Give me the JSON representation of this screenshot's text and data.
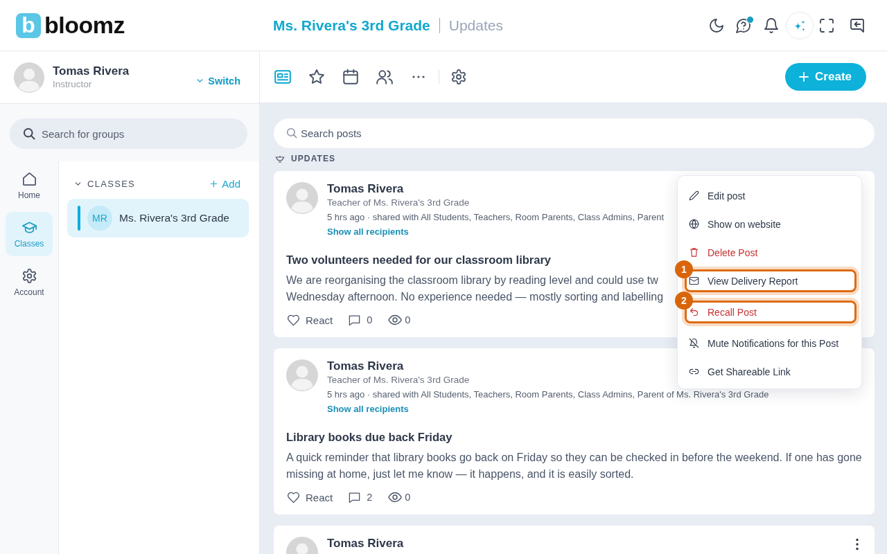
{
  "header": {
    "logo": {
      "mark": "b",
      "wordmark": "bloomz"
    },
    "class_title": "Ms. Rivera's 3rd Grade",
    "page_title": "Updates",
    "help_unread": true
  },
  "profile": {
    "name": "Tomas Rivera",
    "role": "Instructor",
    "switch_label": "Switch"
  },
  "group_search": {
    "placeholder": "Search for groups"
  },
  "nav_rail": [
    {
      "label": "Home",
      "selected": false
    },
    {
      "label": "Classes",
      "selected": true
    },
    {
      "label": "Account",
      "selected": false
    }
  ],
  "classes": {
    "heading": "CLASSES",
    "expanded": true,
    "add_label": "Add",
    "items": [
      {
        "initials": "MR",
        "name": "Ms. Rivera's 3rd Grade",
        "selected": true
      }
    ]
  },
  "toolbar": {
    "tabs": [
      {
        "selected": true
      },
      {
        "selected": false
      },
      {
        "selected": false
      },
      {
        "selected": false
      }
    ],
    "create_label": "Create"
  },
  "post_search": {
    "placeholder": "Search posts"
  },
  "section_label": "UPDATES",
  "posts": [
    {
      "author": "Tomas Rivera",
      "role": "Teacher of Ms. Rivera's 3rd Grade",
      "meta": "5 hrs ago · shared with All Students, Teachers, Room Parents, Class Admins, Parent",
      "recipients_link": "Show all recipients",
      "title": "Two volunteers needed for our classroom library",
      "body_lines": [
        "We are reorganising the classroom library by reading level and could use tw",
        "Wednesday afternoon. No experience needed — mostly sorting and labelling"
      ],
      "react_label": "React",
      "comments": "0",
      "views": "0",
      "menu": {
        "items": [
          {
            "label": "Edit post",
            "kind": "default"
          },
          {
            "label": "Show on website",
            "kind": "default"
          },
          {
            "label": "Delete Post",
            "kind": "destructive"
          },
          {
            "label": "View Delivery Report",
            "kind": "default",
            "callout": "1"
          },
          {
            "label": "Recall Post",
            "kind": "destructive",
            "callout": "2"
          },
          {
            "label": "Mute Notifications for this Post",
            "kind": "default"
          },
          {
            "label": "Get Shareable Link",
            "kind": "default"
          }
        ]
      }
    },
    {
      "author": "Tomas Rivera",
      "role": "Teacher of Ms. Rivera's 3rd Grade",
      "meta": "5 hrs ago · shared with All Students, Teachers, Room Parents, Class Admins, Parent of Ms. Rivera's 3rd Grade",
      "recipients_link": "Show all recipients",
      "title": "Library books due back Friday",
      "body": "A quick reminder that library books go back on Friday so they can be checked in before the weekend. If one has gone missing at home, just let me know — it happens, and it is easily sorted.",
      "react_label": "React",
      "comments": "2",
      "views": "0"
    },
    {
      "author": "Tomas Rivera",
      "more_button": true
    }
  ]
}
